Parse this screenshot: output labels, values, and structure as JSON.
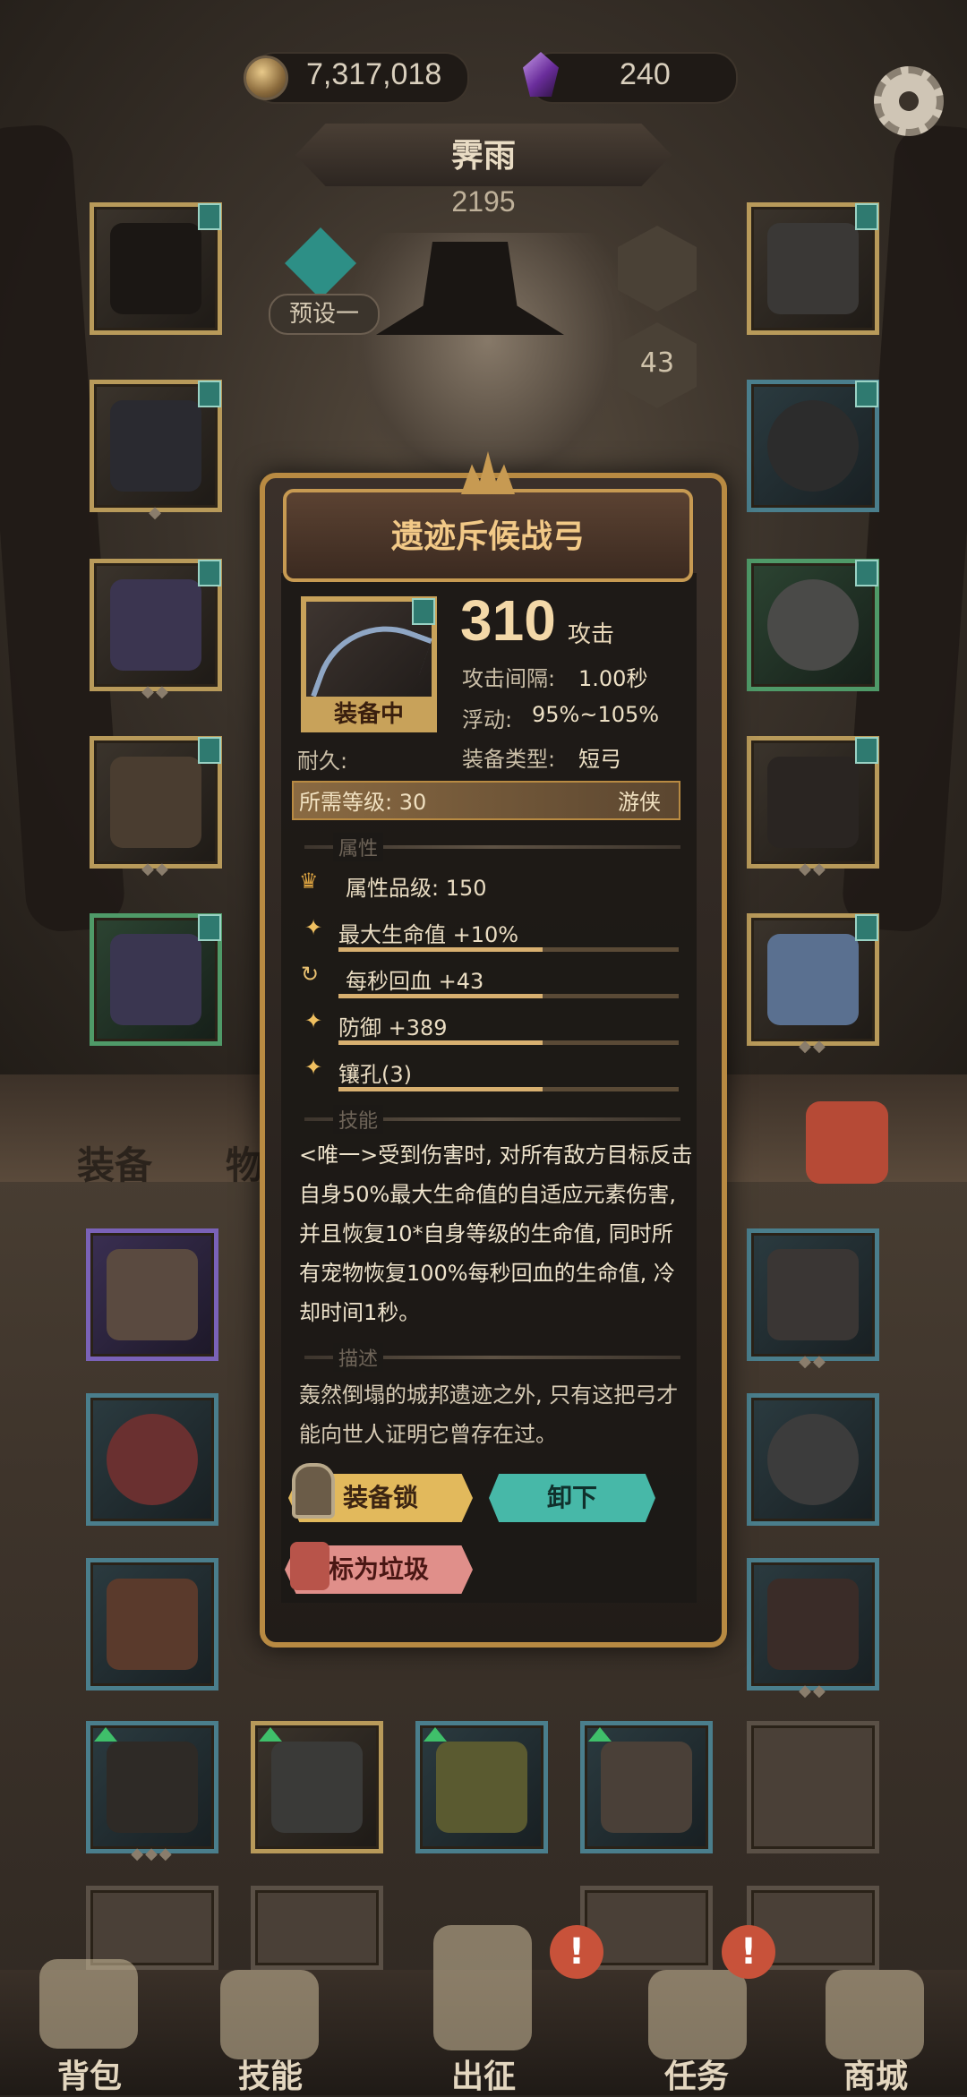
{
  "header": {
    "gold": "7,317,018",
    "gems": "240",
    "gear_icon": "gear-icon"
  },
  "hero": {
    "name": "霁雨",
    "power": "2195",
    "preset": "预设一",
    "level_badge": "43"
  },
  "tabs": {
    "equipment": "装备",
    "items": "物"
  },
  "popup": {
    "title": "遗迹斥候战弓",
    "equipped_label": "装备中",
    "attack_value": "310",
    "attack_unit": "攻击",
    "durability": "耐久:",
    "attack_interval_label": "攻击间隔:",
    "attack_interval": "1.00秒",
    "float_label": "浮动:",
    "float_value": "95%~105%",
    "type_label": "装备类型:",
    "type_value": "短弓",
    "required_level": "所需等级: 30",
    "class": "游侠",
    "section_attributes": "属性",
    "attributes": [
      {
        "icon": "crown-icon",
        "text": "属性品级: 150"
      },
      {
        "icon": "star-icon",
        "text": "最大生命值 +10%"
      },
      {
        "icon": "regen-icon",
        "text": "每秒回血 +43"
      },
      {
        "icon": "star-icon",
        "text": "防御 +389"
      },
      {
        "icon": "star-icon",
        "text": "镶孔(3)"
      }
    ],
    "section_skill": "技能",
    "skill_text": "<唯一>受到伤害时, 对所有敌方目标反击自身50%最大生命值的自适应元素伤害, 并且恢复10*自身等级的生命值, 同时所有宠物恢复100%每秒回血的生命值, 冷却时间1秒。",
    "section_desc": "描述",
    "flavor_text": "轰然倒塌的城邦遗迹之外, 只有这把弓才能向世人证明它曾存在过。",
    "btn_lock": "装备锁",
    "btn_unequip": "卸下",
    "btn_junk": "标为垃圾"
  },
  "nav": {
    "items": [
      {
        "label": "背包"
      },
      {
        "label": "技能"
      },
      {
        "label": "出征"
      },
      {
        "label": "任务"
      },
      {
        "label": "商城"
      }
    ],
    "alert": "!"
  },
  "colors": {
    "gold_accent": "#c8a25a",
    "teal_button": "#47b8a8",
    "junk_button": "#e08f8a"
  }
}
